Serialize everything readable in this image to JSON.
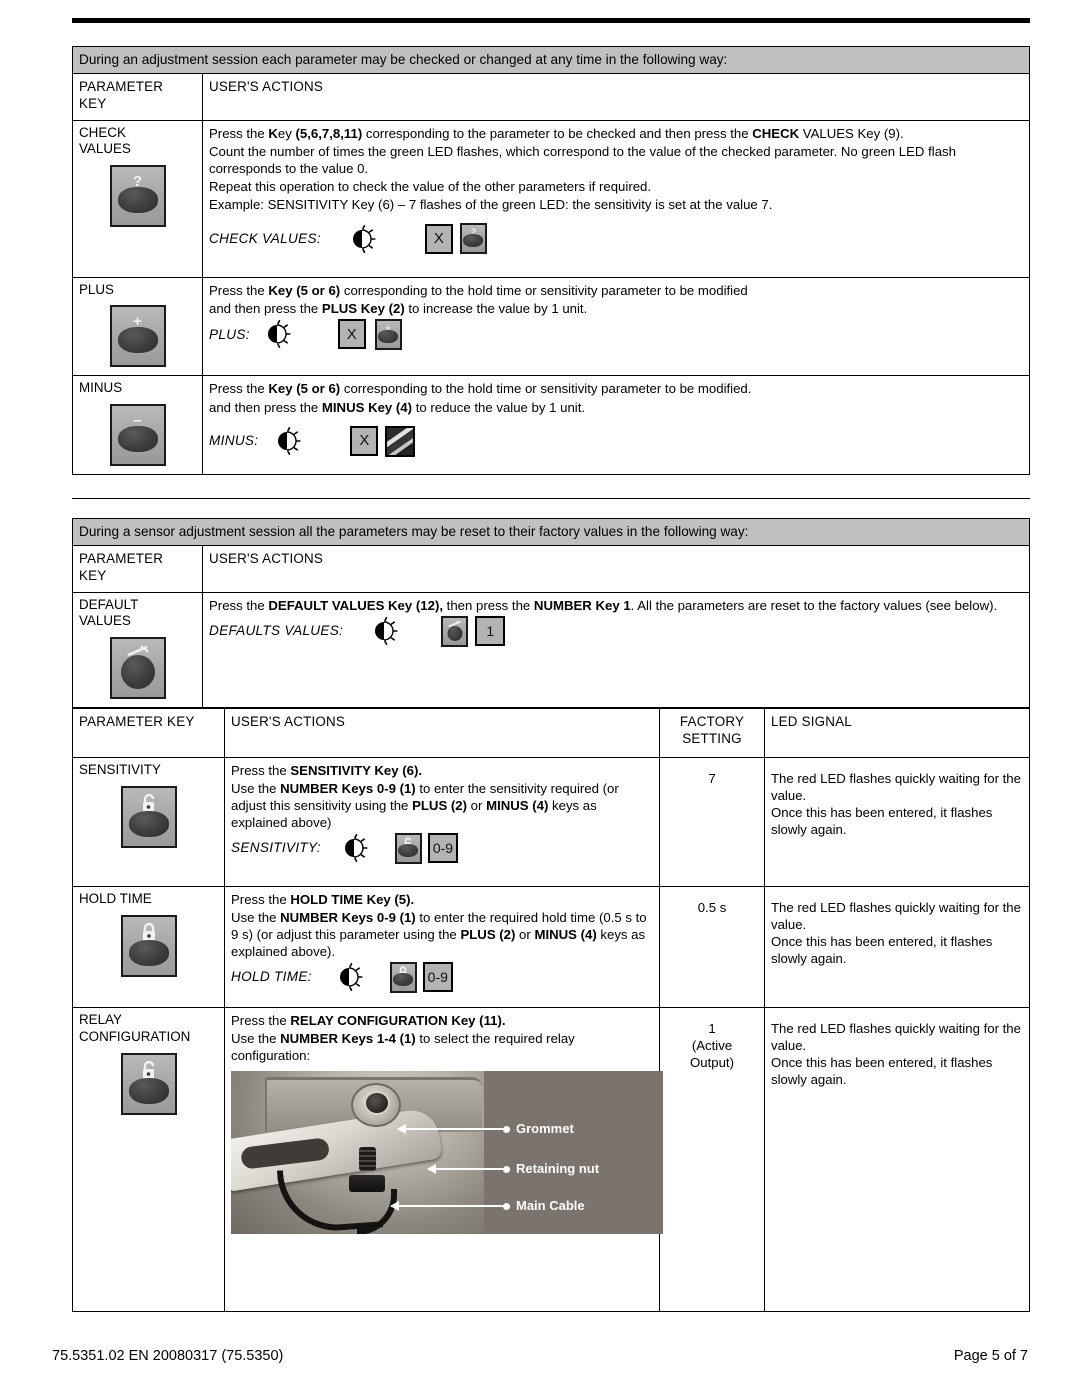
{
  "document": {
    "footer_left": "75.5351.02  EN   20080317   (75.5350)",
    "footer_right": "Page 5 of 7"
  },
  "table1": {
    "banner": "During an adjustment session each parameter may be checked or changed at any time in the following way:",
    "headers": {
      "col1_line1": "PARAMETER",
      "col1_line2": "KEY",
      "col2": "USER'S ACTIONS"
    },
    "rows": [
      {
        "key_line1": "CHECK",
        "key_line2": "VALUES",
        "key_icon": "question-key-icon",
        "key_mark": "?",
        "paragraphs": [
          "Press the Key (5,6,7,8,11) corresponding to the parameter to be checked and then press the CHECK VALUES Key (9).",
          "Count the number of times the green LED flashes, which correspond to the value of the checked parameter. No green LED flash corresponds to the value 0.",
          "Repeat this operation to check the value of the other parameters if required.",
          "Example:  SENSITIVITY Key (6)  – 7 flashes of the green LED: the sensitivity is set at the value 7."
        ],
        "sequence_label": "CHECK VALUES:",
        "sequence": [
          "led-flash-icon",
          "x-box",
          "question-key-icon"
        ],
        "x_label": "X"
      },
      {
        "key_line1": "PLUS",
        "key_line2": "",
        "key_icon": "plus-key-icon",
        "key_mark": "+",
        "paragraphs": [
          "Press the Key (5 or 6) corresponding to the hold time or sensitivity parameter to be modified",
          "and then press the PLUS Key (2) to increase the value by 1 unit."
        ],
        "sequence_label": "PLUS:",
        "sequence": [
          "led-flash-icon",
          "x-box",
          "plus-key-icon"
        ],
        "x_label": "X"
      },
      {
        "key_line1": "MINUS",
        "key_line2": "",
        "key_icon": "minus-key-icon",
        "key_mark": "–",
        "paragraphs": [
          "Press the Key (5 or 6) corresponding to the hold time or sensitivity parameter to be modified.",
          "and then press the MINUS Key (4) to reduce the value by 1 unit."
        ],
        "sequence_label": "MINUS:",
        "sequence": [
          "led-flash-icon",
          "x-box",
          "photo-chip-icon"
        ],
        "x_label": "X"
      }
    ]
  },
  "table2": {
    "banner": "During a sensor adjustment session all the parameters may be reset to their factory values in the following way:",
    "headers": {
      "col1_line1": "PARAMETER",
      "col1_line2": "KEY",
      "col2": "USER'S ACTIONS"
    },
    "row": {
      "key_line1": "DEFAULT",
      "key_line2": "VALUES",
      "key_icon": "default-values-key-icon",
      "paragraphs": [
        "Press the DEFAULT VALUES Key (12), then press the NUMBER Key 1.  All the parameters are reset to the factory values (see below)."
      ],
      "sequence_label": "DEFAULTS VALUES:",
      "sequence": [
        "led-flash-icon",
        "default-values-key-icon",
        "number-box-1"
      ],
      "number_label": "1"
    }
  },
  "table3": {
    "headers": {
      "col1": "PARAMETER KEY",
      "col2": "USER'S ACTIONS",
      "col3_line1": "FACTORY",
      "col3_line2": "SETTING",
      "col4": "LED SIGNAL"
    },
    "rows": [
      {
        "key_label": "SENSITIVITY",
        "key_icon": "open-padlock-key-icon",
        "paragraphs": [
          "Press the SENSITIVITY Key (6).",
          "Use the NUMBER Keys 0-9 (1) to enter the sensitivity required  (or adjust this sensitivity using the PLUS (2) or MINUS (4) keys as explained above)"
        ],
        "sequence_label": "SENSITIVITY:",
        "sequence": [
          "led-flash-icon",
          "open-padlock-key-icon",
          "number-range-box"
        ],
        "range_label": "0-9",
        "factory_setting": "7",
        "factory_setting_note": "",
        "led_signal": "The red LED flashes quickly waiting for the value.\nOnce this has been entered, it flashes slowly again."
      },
      {
        "key_label": "HOLD TIME",
        "key_icon": "closed-padlock-key-icon",
        "paragraphs": [
          "Press the HOLD TIME Key (5).",
          "Use the NUMBER Keys 0-9 (1) to enter the required hold time (0.5 s to 9 s)  (or adjust this parameter using the PLUS (2) or MINUS (4) keys as explained above)."
        ],
        "sequence_label": "HOLD TIME:",
        "sequence": [
          "led-flash-icon",
          "closed-padlock-key-icon",
          "number-range-box"
        ],
        "range_label": "0-9",
        "factory_setting": "0.5 s",
        "factory_setting_note": "",
        "led_signal": "The red LED flashes quickly waiting for the value.\nOnce this has been entered, it flashes slowly again."
      },
      {
        "key_label_line1": "RELAY",
        "key_label_line2": "CONFIGURATION",
        "key_icon": "open-padlock-key-icon",
        "paragraphs": [
          "Press the RELAY CONFIGURATION Key (11).",
          "Use the NUMBER Keys 1-4 (1) to select the required relay configuration:"
        ],
        "factory_setting": "1",
        "factory_setting_note_line1": "(Active",
        "factory_setting_note_line2": "Output)",
        "led_signal": "The red LED flashes quickly waiting for the value.\nOnce this has been entered, it flashes slowly again.",
        "figure": {
          "callouts": [
            "Grommet",
            "Retaining nut",
            "Main Cable"
          ]
        }
      }
    ]
  }
}
